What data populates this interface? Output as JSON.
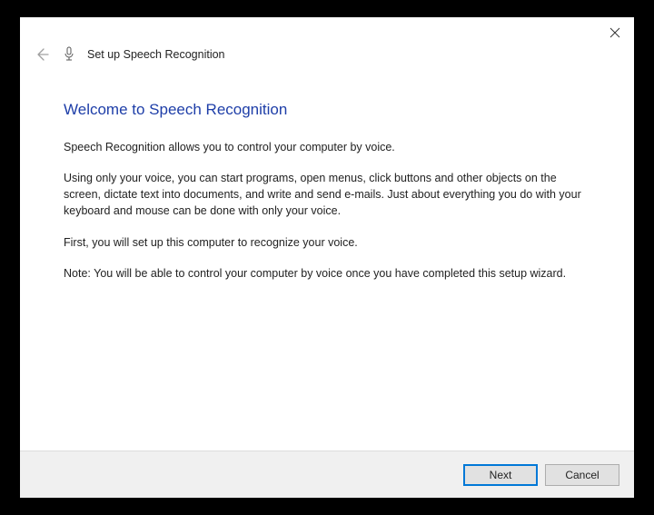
{
  "header": {
    "title": "Set up Speech Recognition"
  },
  "content": {
    "heading": "Welcome to Speech Recognition",
    "para1": "Speech Recognition allows you to control your computer by voice.",
    "para2": "Using only your voice, you can start programs, open menus, click buttons and other objects on the screen, dictate text into documents, and write and send e-mails. Just about everything you do with your keyboard and mouse can be done with only your voice.",
    "para3": "First, you will set up this computer to recognize your voice.",
    "para4": "Note: You will be able to control your computer by voice once you have completed this setup wizard."
  },
  "footer": {
    "next_label": "Next",
    "cancel_label": "Cancel"
  }
}
